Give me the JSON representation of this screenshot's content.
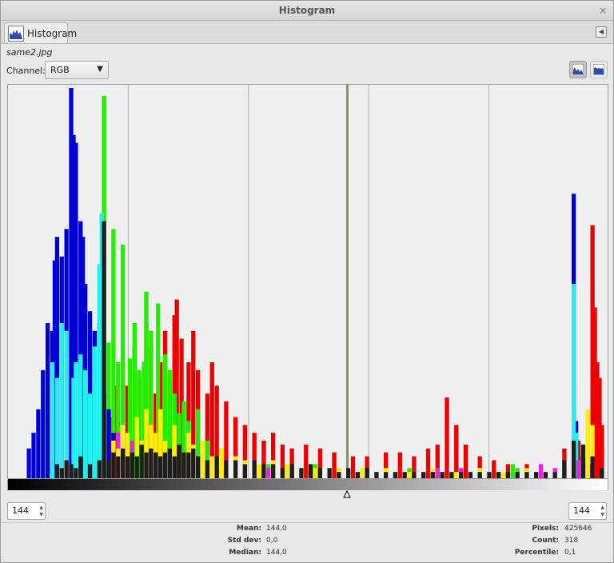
{
  "window": {
    "title": "Histogram",
    "close_glyph": "×"
  },
  "tab": {
    "label": "Histogram",
    "icon": "histogram-icon"
  },
  "filename": "same2.jpg",
  "channel": {
    "label": "Channel:",
    "value": "RGB"
  },
  "scale_mode": {
    "linear": "linear-histogram-icon",
    "logarithmic": "log-histogram-icon",
    "active": "linear"
  },
  "range": {
    "start": "144",
    "end": "144",
    "marker_value": 144
  },
  "stats": {
    "mean_label": "Mean:",
    "mean": "144,0",
    "stddev_label": "Std dev:",
    "stddev": "0,0",
    "median_label": "Median:",
    "median": "144,0",
    "pixels_label": "Pixels:",
    "pixels": "425646",
    "count_label": "Count:",
    "count": "318",
    "percentile_label": "Percentile:",
    "percentile": "0,1"
  },
  "colors": {
    "red": "#ee0000",
    "green": "#22ee00",
    "blue": "#0000d6",
    "cyan": "#22f0f0",
    "magenta": "#ee22dd",
    "yellow": "#ffee00",
    "black": "#1e1e1e",
    "selection": "#7e9a4a"
  },
  "chart_data": {
    "type": "bar",
    "x_range": [
      0,
      255
    ],
    "selected_value": 144,
    "series": [
      {
        "name": "Red",
        "points": [
          [
            42,
            14
          ],
          [
            43,
            16
          ],
          [
            45,
            24
          ],
          [
            46,
            20
          ],
          [
            48,
            30
          ],
          [
            50,
            24
          ],
          [
            53,
            34
          ],
          [
            55,
            26
          ],
          [
            58,
            40
          ],
          [
            60,
            34
          ],
          [
            62,
            22
          ],
          [
            64,
            30
          ],
          [
            66,
            38
          ],
          [
            68,
            26
          ],
          [
            70,
            42
          ],
          [
            71,
            46
          ],
          [
            73,
            36
          ],
          [
            76,
            30
          ],
          [
            78,
            38
          ],
          [
            80,
            28
          ],
          [
            84,
            22
          ],
          [
            86,
            30
          ],
          [
            88,
            24
          ],
          [
            92,
            20
          ],
          [
            96,
            16
          ],
          [
            100,
            14
          ],
          [
            104,
            12
          ],
          [
            108,
            10
          ],
          [
            112,
            12
          ],
          [
            116,
            9
          ],
          [
            120,
            8
          ],
          [
            126,
            9
          ],
          [
            132,
            8
          ],
          [
            138,
            7
          ],
          [
            146,
            6
          ],
          [
            152,
            6
          ],
          [
            160,
            7
          ],
          [
            166,
            7
          ],
          [
            172,
            6
          ],
          [
            178,
            8
          ],
          [
            182,
            9
          ],
          [
            186,
            21
          ],
          [
            190,
            14
          ],
          [
            194,
            9
          ],
          [
            200,
            6
          ],
          [
            206,
            5
          ],
          [
            212,
            4
          ],
          [
            220,
            4
          ],
          [
            236,
            8
          ],
          [
            242,
            10
          ],
          [
            248,
            65
          ],
          [
            249,
            44
          ],
          [
            250,
            30
          ],
          [
            251,
            26
          ],
          [
            252,
            14
          ]
        ]
      },
      {
        "name": "Green",
        "points": [
          [
            40,
            98
          ],
          [
            42,
            35
          ],
          [
            44,
            64
          ],
          [
            46,
            30
          ],
          [
            48,
            60
          ],
          [
            51,
            31
          ],
          [
            53,
            40
          ],
          [
            55,
            28
          ],
          [
            57,
            30
          ],
          [
            58,
            48
          ],
          [
            60,
            38
          ],
          [
            63,
            45
          ],
          [
            66,
            32
          ],
          [
            68,
            28
          ],
          [
            70,
            22
          ],
          [
            72,
            17
          ],
          [
            74,
            20
          ],
          [
            76,
            15
          ],
          [
            80,
            18
          ],
          [
            84,
            10
          ],
          [
            90,
            8
          ],
          [
            96,
            5
          ],
          [
            100,
            5
          ],
          [
            110,
            4
          ],
          [
            120,
            3
          ],
          [
            130,
            4
          ],
          [
            140,
            3
          ],
          [
            150,
            2
          ],
          [
            160,
            2
          ],
          [
            170,
            3
          ],
          [
            180,
            2
          ],
          [
            190,
            2
          ],
          [
            200,
            3
          ],
          [
            214,
            4
          ],
          [
            216,
            3
          ],
          [
            240,
            18
          ],
          [
            246,
            17
          ]
        ]
      },
      {
        "name": "Blue",
        "points": [
          [
            8,
            8
          ],
          [
            10,
            12
          ],
          [
            12,
            18
          ],
          [
            14,
            28
          ],
          [
            16,
            40
          ],
          [
            18,
            38
          ],
          [
            19,
            56
          ],
          [
            20,
            62
          ],
          [
            22,
            57
          ],
          [
            24,
            64
          ],
          [
            26,
            100
          ],
          [
            27,
            88
          ],
          [
            28,
            86
          ],
          [
            30,
            66
          ],
          [
            31,
            62
          ],
          [
            32,
            50
          ],
          [
            34,
            43
          ],
          [
            36,
            38
          ],
          [
            38,
            40
          ],
          [
            39,
            48
          ],
          [
            40,
            22
          ],
          [
            42,
            18
          ],
          [
            44,
            12
          ],
          [
            46,
            10
          ],
          [
            48,
            8
          ],
          [
            52,
            6
          ],
          [
            56,
            5
          ],
          [
            60,
            4
          ],
          [
            64,
            3
          ],
          [
            80,
            2
          ],
          [
            240,
            73
          ],
          [
            241,
            15
          ],
          [
            244,
            6
          ],
          [
            246,
            4
          ]
        ]
      },
      {
        "name": "Cyan",
        "points": [
          [
            18,
            30
          ],
          [
            20,
            26
          ],
          [
            22,
            40
          ],
          [
            24,
            38
          ],
          [
            27,
            26
          ],
          [
            28,
            30
          ],
          [
            30,
            32
          ],
          [
            32,
            28
          ],
          [
            34,
            22
          ],
          [
            36,
            34
          ],
          [
            38,
            55
          ],
          [
            39,
            68
          ],
          [
            40,
            18
          ],
          [
            240,
            50
          ],
          [
            241,
            12
          ]
        ]
      },
      {
        "name": "Magenta",
        "points": [
          [
            46,
            12
          ],
          [
            48,
            10
          ],
          [
            50,
            8
          ],
          [
            52,
            10
          ],
          [
            56,
            6
          ],
          [
            58,
            8
          ],
          [
            60,
            12
          ],
          [
            62,
            10
          ],
          [
            64,
            6
          ],
          [
            66,
            8
          ],
          [
            68,
            5
          ],
          [
            70,
            5
          ],
          [
            74,
            5
          ],
          [
            78,
            4
          ],
          [
            84,
            3
          ],
          [
            90,
            3
          ],
          [
            100,
            3
          ],
          [
            110,
            3
          ],
          [
            120,
            2
          ],
          [
            150,
            2
          ],
          [
            182,
            3
          ],
          [
            192,
            3
          ],
          [
            226,
            4
          ],
          [
            232,
            3
          ],
          [
            236,
            3
          ],
          [
            242,
            5
          ],
          [
            247,
            4
          ]
        ]
      },
      {
        "name": "Yellow",
        "points": [
          [
            44,
            10
          ],
          [
            46,
            8
          ],
          [
            48,
            14
          ],
          [
            50,
            12
          ],
          [
            54,
            16
          ],
          [
            56,
            10
          ],
          [
            58,
            18
          ],
          [
            60,
            14
          ],
          [
            62,
            12
          ],
          [
            64,
            18
          ],
          [
            66,
            10
          ],
          [
            70,
            14
          ],
          [
            72,
            8
          ],
          [
            76,
            12
          ],
          [
            78,
            9
          ],
          [
            82,
            10
          ],
          [
            86,
            6
          ],
          [
            90,
            8
          ],
          [
            96,
            6
          ],
          [
            100,
            5
          ],
          [
            106,
            4
          ],
          [
            112,
            5
          ],
          [
            118,
            4
          ],
          [
            124,
            3
          ],
          [
            130,
            3
          ],
          [
            140,
            3
          ],
          [
            150,
            3
          ],
          [
            160,
            3
          ],
          [
            170,
            2
          ],
          [
            180,
            3
          ],
          [
            190,
            2
          ],
          [
            200,
            3
          ],
          [
            210,
            2
          ],
          [
            220,
            3
          ],
          [
            246,
            18
          ],
          [
            248,
            14
          ]
        ]
      },
      {
        "name": "Black",
        "points": [
          [
            20,
            4
          ],
          [
            22,
            3
          ],
          [
            24,
            5
          ],
          [
            26,
            4
          ],
          [
            28,
            3
          ],
          [
            30,
            6
          ],
          [
            34,
            4
          ],
          [
            38,
            5
          ],
          [
            40,
            66
          ],
          [
            42,
            5
          ],
          [
            44,
            7
          ],
          [
            46,
            6
          ],
          [
            48,
            8
          ],
          [
            50,
            6
          ],
          [
            52,
            7
          ],
          [
            54,
            6
          ],
          [
            56,
            9
          ],
          [
            58,
            7
          ],
          [
            60,
            8
          ],
          [
            62,
            7
          ],
          [
            64,
            6
          ],
          [
            66,
            7
          ],
          [
            68,
            8
          ],
          [
            70,
            6
          ],
          [
            72,
            9
          ],
          [
            74,
            7
          ],
          [
            76,
            7
          ],
          [
            78,
            8
          ],
          [
            80,
            6
          ],
          [
            84,
            5
          ],
          [
            88,
            6
          ],
          [
            92,
            5
          ],
          [
            96,
            5
          ],
          [
            100,
            4
          ],
          [
            104,
            5
          ],
          [
            108,
            4
          ],
          [
            112,
            4
          ],
          [
            116,
            3
          ],
          [
            120,
            4
          ],
          [
            124,
            3
          ],
          [
            128,
            4
          ],
          [
            132,
            3
          ],
          [
            136,
            3
          ],
          [
            140,
            2
          ],
          [
            144,
            3
          ],
          [
            148,
            2
          ],
          [
            152,
            3
          ],
          [
            156,
            2
          ],
          [
            160,
            2
          ],
          [
            164,
            2
          ],
          [
            168,
            2
          ],
          [
            172,
            2
          ],
          [
            176,
            2
          ],
          [
            180,
            2
          ],
          [
            184,
            2
          ],
          [
            188,
            2
          ],
          [
            192,
            2
          ],
          [
            196,
            2
          ],
          [
            200,
            2
          ],
          [
            204,
            2
          ],
          [
            208,
            2
          ],
          [
            212,
            2
          ],
          [
            216,
            2
          ],
          [
            220,
            2
          ],
          [
            224,
            2
          ],
          [
            228,
            2
          ],
          [
            232,
            2
          ],
          [
            236,
            5
          ],
          [
            240,
            10
          ],
          [
            244,
            9
          ],
          [
            248,
            6
          ],
          [
            252,
            3
          ]
        ]
      }
    ],
    "value_scale": "linear"
  }
}
